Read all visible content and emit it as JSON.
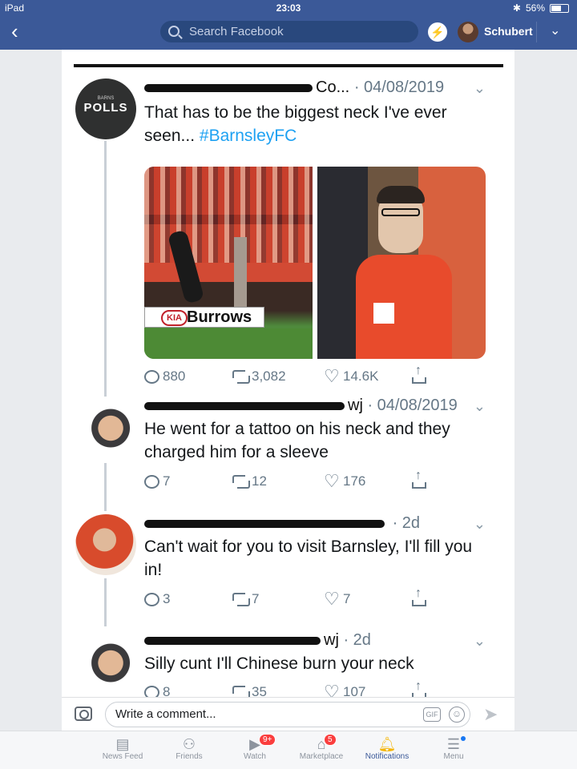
{
  "status": {
    "device": "iPad",
    "time": "23:03",
    "battery": "56%"
  },
  "header": {
    "search_placeholder": "Search Facebook",
    "user_name": "Schubert"
  },
  "tweets": [
    {
      "author_visible": "Co...",
      "date": "· 04/08/2019",
      "avatar_label": "POLLS",
      "avatar_sublabel": "BARNS",
      "text": "That has to be the biggest neck I've ever seen...",
      "hashtag": "#BarnsleyFC",
      "photo_board_text": "Burrows",
      "photo_board_brand": "KIA",
      "replies": "880",
      "retweets": "3,082",
      "likes": "14.6K"
    },
    {
      "author_visible": "wj",
      "date": "· 04/08/2019",
      "text": "He went for a tattoo on his neck and they charged him for a sleeve",
      "replies": "7",
      "retweets": "12",
      "likes": "176"
    },
    {
      "author_visible": "",
      "date": "· 2d",
      "text": "Can't wait for you to visit Barnsley, I'll fill you in!",
      "replies": "3",
      "retweets": "7",
      "likes": "7"
    },
    {
      "author_visible": "wj",
      "date": "· 2d",
      "text": "Silly cunt I'll Chinese burn your neck",
      "replies": "8",
      "retweets": "35",
      "likes": "107"
    }
  ],
  "comment_bar": {
    "placeholder": "Write a comment...",
    "gif_label": "GIF"
  },
  "bottom_nav": [
    {
      "label": "News Feed"
    },
    {
      "label": "Friends"
    },
    {
      "label": "Watch",
      "badge": "9+"
    },
    {
      "label": "Marketplace",
      "badge": "5"
    },
    {
      "label": "Notifications",
      "active": true
    },
    {
      "label": "Menu"
    }
  ],
  "colors": {
    "fb_blue": "#3b5998",
    "twitter_blue": "#1da1f2",
    "badge_red": "#fa3e3e"
  }
}
